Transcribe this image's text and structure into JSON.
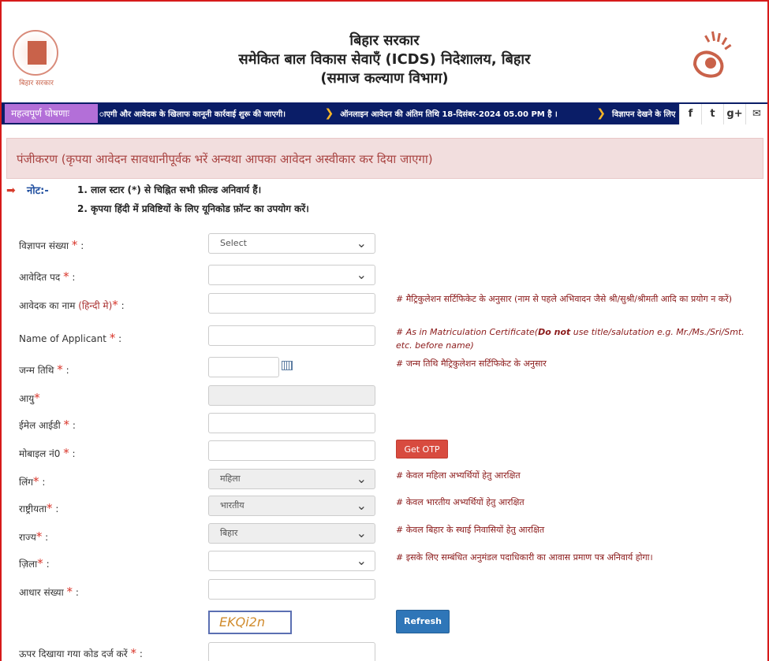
{
  "header": {
    "logo_left_caption": "बिहार सरकार",
    "title_line1": "बिहार सरकार",
    "title_line2": "समेकित बाल विकास सेवाएँ (ICDS) निदेशालय, बिहार",
    "title_line3": "(समाज कल्याण विभाग)"
  },
  "ticker": {
    "label": "महत्वपूर्ण घोषणाः",
    "items": [
      "ाएगी और आवेदक के खिलाफ कानूनी कार्रवाई शुरू की जाएगी।",
      "ऑनलाइन आवेदन की अंतिम तिथि 18-दिसंबर-2024 05.00 PM है ।",
      "विज्ञापन देखने के लिए"
    ]
  },
  "social": {
    "facebook": "f",
    "twitter": "t",
    "googleplus": "g+",
    "mail": "✉"
  },
  "banner": {
    "text": "पंजीकरण (कृपया आवेदन सावधानीपूर्वक भरें अन्यथा आपका आवेदन अस्वीकार कर दिया जाएगा)"
  },
  "note": {
    "label": "नोट:-",
    "line1": "1. लाल स्टार (*) से चिह्नित सभी फ़ील्ड अनिवार्य हैं।",
    "line2": "2. कृपया हिंदी में प्रविष्टियों के लिए यूनिकोड फ़ॉन्ट का उपयोग करें।"
  },
  "form": {
    "vigyapan_label": "विज्ञापन संख्या",
    "vigyapan_value": "Select",
    "aavedit_label": "आवेदित पद",
    "name_hindi_label": "आवेदक का नाम",
    "name_hindi_hint": "(हिन्दी मे)",
    "name_hindi_help": "# मैट्रिकुलेशन सर्टिफिकेट के अनुसार (नाम से पहले अभिवादन जैसे श्री/सुश्री/श्रीमती आदि का प्रयोग न करें)",
    "name_eng_label": "Name of Applicant",
    "name_eng_help_a": "# As in Matriculation Certificate(",
    "name_eng_help_b": "Do not",
    "name_eng_help_c": " use title/salutation e.g. Mr./Ms./Sri/Smt. etc. before name)",
    "dob_label": "जन्म तिथि",
    "dob_help": "# जन्म तिथि मैट्रिकुलेशन सर्टिफिकेट के अनुसार",
    "age_label": "आयु",
    "email_label": "ईमेल आईडी",
    "mobile_label": "मोबाइल नं0",
    "otp_button": "Get OTP",
    "gender_label": "लिंग",
    "gender_value": "महिला",
    "gender_help": "# केवल महिला अभ्यर्थियों हेतु आरक्षित",
    "nationality_label": "राष्ट्रीयता",
    "nationality_value": "भारतीय",
    "nationality_help": "# केवल भारतीय अभ्यर्थियों हेतु आरक्षित",
    "state_label": "राज्य",
    "state_value": "बिहार",
    "state_help": "# केवल बिहार के स्थाई निवासियों हेतु आरक्षित",
    "district_label": "ज़िला",
    "district_help": "# इसके लिए सम्बंधित अनुमंडल पदाधिकारी का आवास प्रमाण पत्र अनिवार्य होगा।",
    "aadhar_label": "आधार संख्या",
    "captcha_text": "EKQi2n",
    "refresh_button": "Refresh",
    "captcha_label": "ऊपर दिखाया गया कोड दर्ज करें"
  },
  "colors": {
    "accent_red": "#d61a1a",
    "ticker_bg": "#0a1d67",
    "ticker_label_bg": "#b36fd8",
    "banner_bg": "#f2dede"
  }
}
